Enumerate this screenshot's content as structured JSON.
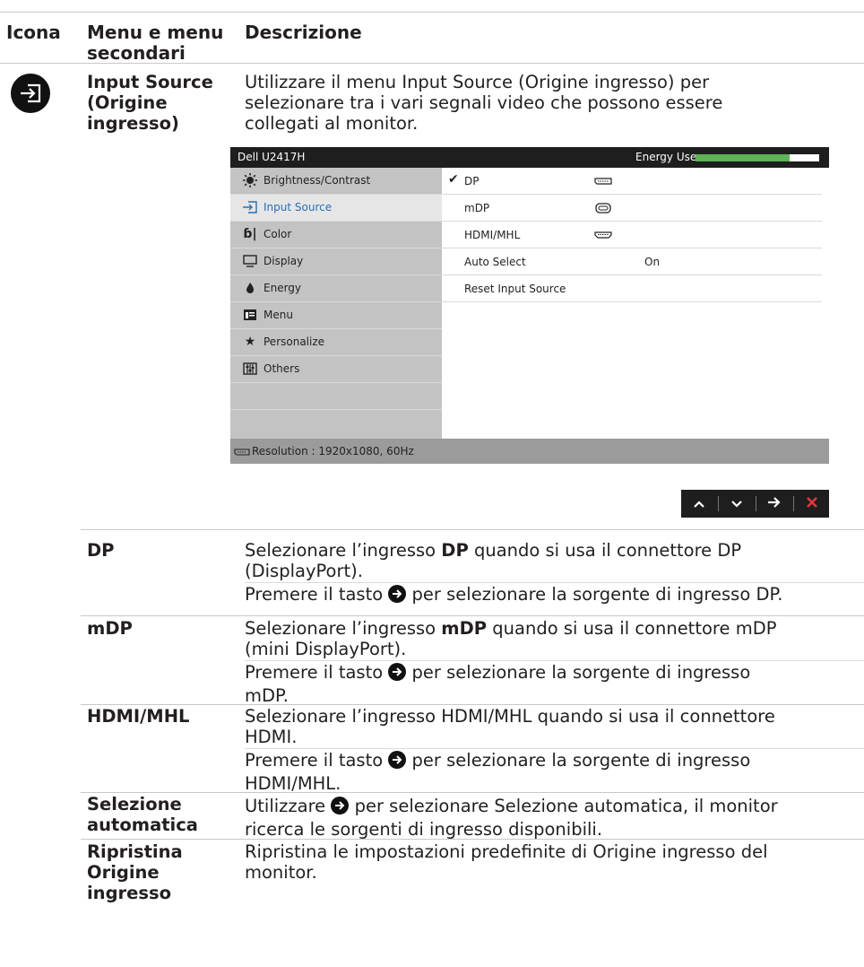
{
  "header": {
    "col_icon": "Icona",
    "col_menu_line1": "Menu e menu",
    "col_menu_line2": "secondari",
    "col_desc": "Descrizione"
  },
  "input_source": {
    "name_line1": "Input Source",
    "name_line2": "(Origine",
    "name_line3": "ingresso)",
    "desc_line1": "Utilizzare il menu Input Source (Origine ingresso) per",
    "desc_line2": "selezionare tra i vari segnali video che possono essere",
    "desc_line3": "collegati al monitor."
  },
  "osd": {
    "title": "Dell U2417H",
    "energy_label": "Energy Use",
    "energy_level_percent": 76,
    "menu": [
      {
        "icon": "brightness-icon",
        "label": "Brightness/Contrast"
      },
      {
        "icon": "input-source-icon",
        "label": "Input Source"
      },
      {
        "icon": "color-icon",
        "label": "Color"
      },
      {
        "icon": "display-icon",
        "label": "Display"
      },
      {
        "icon": "energy-icon",
        "label": "Energy"
      },
      {
        "icon": "menu-icon",
        "label": "Menu"
      },
      {
        "icon": "star-icon",
        "label": "Personalize"
      },
      {
        "icon": "others-icon",
        "label": "Others"
      }
    ],
    "options": [
      {
        "label": "DP",
        "checked": true,
        "connector": "dp-connector-icon",
        "value": ""
      },
      {
        "label": "mDP",
        "checked": false,
        "connector": "mdp-connector-icon",
        "value": ""
      },
      {
        "label": "HDMI/MHL",
        "checked": false,
        "connector": "hdmi-connector-icon",
        "value": ""
      },
      {
        "label": "Auto Select",
        "checked": false,
        "connector": "",
        "value": "On"
      },
      {
        "label": "Reset Input Source",
        "checked": false,
        "connector": "",
        "value": ""
      }
    ],
    "resolution": "Resolution : 1920x1080, 60Hz",
    "accent_color": "#2b6fb5",
    "energy_bar_color": "#5fb356"
  },
  "nav_buttons": [
    {
      "icon": "chevron-up-icon",
      "glyph": "⌃"
    },
    {
      "icon": "chevron-down-icon",
      "glyph": "⌄"
    },
    {
      "icon": "arrow-right-icon",
      "glyph": "→"
    },
    {
      "icon": "close-icon",
      "glyph": "✕"
    }
  ],
  "rows": {
    "dp": {
      "name": "DP",
      "d1_pre": "Selezionare l’ingresso ",
      "d1_bold": "DP",
      "d1_post": " quando si usa il connettore DP",
      "d2": "(DisplayPort).",
      "p_pre": "Premere il tasto ",
      "p_post": " per selezionare la sorgente di ingresso DP."
    },
    "mdp": {
      "name": "mDP",
      "d1_pre": "Selezionare l’ingresso ",
      "d1_bold": "mDP",
      "d1_post": " quando si usa il connettore mDP",
      "d2": "(mini DisplayPort).",
      "p_pre": "Premere il tasto ",
      "p_post": " per selezionare la sorgente di ingresso",
      "p2": "mDP."
    },
    "hdmi": {
      "name": "HDMI/MHL",
      "d1": "Selezionare l’ingresso HDMI/MHL quando si usa il connettore",
      "d2": "HDMI.",
      "p_pre": "Premere il tasto ",
      "p_post": " per selezionare la sorgente di ingresso",
      "p2": "HDMI/MHL."
    },
    "auto": {
      "name_line1": "Selezione",
      "name_line2": "automatica",
      "d1_pre": "Utilizzare ",
      "d1_post": " per selezionare Selezione automatica, il monitor",
      "d2": "ricerca le sorgenti di ingresso disponibili."
    },
    "reset": {
      "name_line1": "Ripristina",
      "name_line2": "Origine",
      "name_line3": "ingresso",
      "d1": "Ripristina le impostazioni predefinite di Origine ingresso del",
      "d2": "monitor."
    }
  }
}
